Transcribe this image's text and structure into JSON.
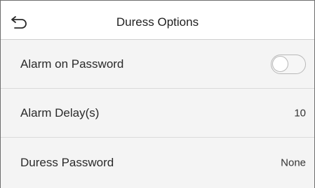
{
  "header": {
    "title": "Duress Options",
    "back_icon": "back-arrow-icon"
  },
  "rows": [
    {
      "label": "Alarm on Password",
      "control": "toggle",
      "state": "off"
    },
    {
      "label": "Alarm Delay(s)",
      "value": "10"
    },
    {
      "label": "Duress Password",
      "value": "None"
    }
  ],
  "colors": {
    "background": "#f4f4f4",
    "header_background": "#ffffff",
    "divider": "#dadada",
    "toggle_border": "#b8b8b8"
  }
}
